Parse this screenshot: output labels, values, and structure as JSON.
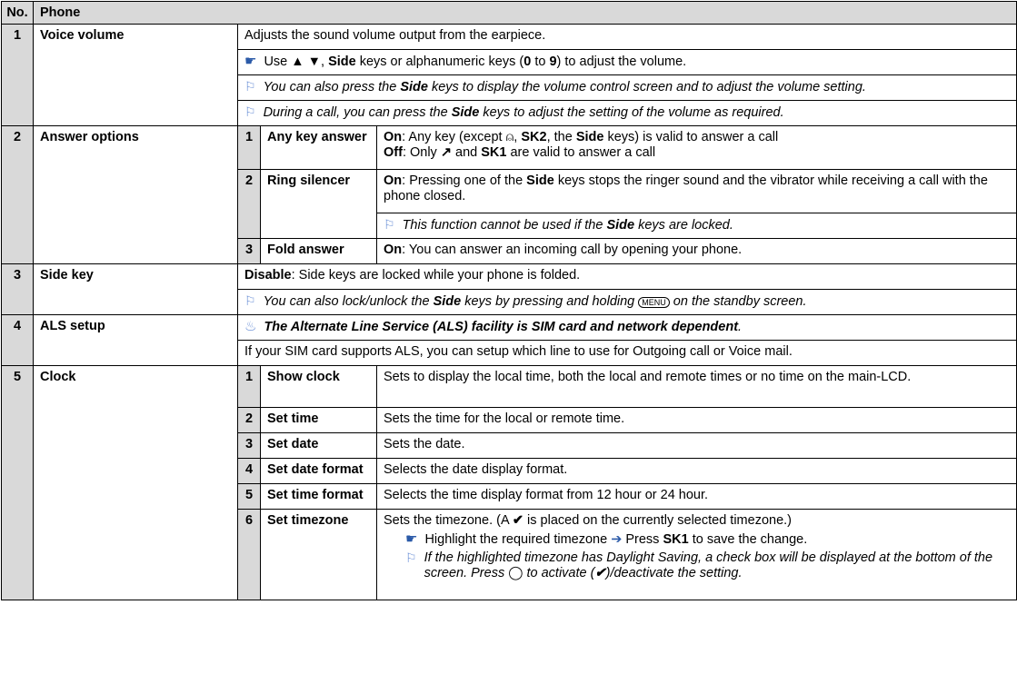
{
  "header": {
    "no_label": "No.",
    "title": "Phone"
  },
  "rows": {
    "r1": {
      "num": "1",
      "name": "Voice volume",
      "desc": "Adjusts the sound volume output from the earpiece.",
      "tip_a": "Use ▲ ▼, ",
      "tip_b": "Side",
      "tip_c": " keys or alphanumeric keys (",
      "tip_d": "0",
      "tip_e": " to ",
      "tip_f": "9",
      "tip_g": ") to adjust the volume.",
      "note1_a": "You can also press the ",
      "note1_b": "Side",
      "note1_c": " keys to display the volume control screen and to adjust the volume setting.",
      "note2_a": "During a call, you can press the ",
      "note2_b": "Side",
      "note2_c": " keys to adjust the setting of the volume as required."
    },
    "r2": {
      "num": "2",
      "name": "Answer options",
      "s1": {
        "num": "1",
        "name": "Any key answer",
        "on_label": "On",
        "on_a": ": Any key (except ",
        "on_b": ", ",
        "on_c": "SK2",
        "on_d": ", the ",
        "on_e": "Side",
        "on_f": " keys) is valid to answer a call",
        "off_label": "Off",
        "off_a": ": Only ",
        "off_b": " and ",
        "off_c": "SK1",
        "off_d": " are valid to answer a call"
      },
      "s2": {
        "num": "2",
        "name": "Ring silencer",
        "on_label": "On",
        "on_a": ": Pressing one of the ",
        "on_b": "Side",
        "on_c": " keys stops the ringer sound and the vibrator while receiving a call with the phone closed.",
        "note_a": "This function cannot be used if the ",
        "note_b": "Side",
        "note_c": " keys are locked."
      },
      "s3": {
        "num": "3",
        "name": "Fold answer",
        "on_label": "On",
        "on_a": ": You can answer an incoming call by opening your phone."
      }
    },
    "r3": {
      "num": "3",
      "name": "Side key",
      "dis_label": "Disable",
      "dis_text": ": Side keys are locked while your phone is folded.",
      "note_a": "You can also lock/unlock the ",
      "note_b": "Side",
      "note_c": " keys by pressing and holding ",
      "note_d": " on the standby screen."
    },
    "r4": {
      "num": "4",
      "name": "ALS setup",
      "warn": "The Alternate Line Service (ALS) facility is SIM card and network dependent",
      "warn_end": ".",
      "desc": "If your SIM card supports ALS, you can setup which line to use for Outgoing call or Voice mail."
    },
    "r5": {
      "num": "5",
      "name": "Clock",
      "subs": [
        {
          "num": "1",
          "name": "Show clock",
          "desc": "Sets to display the local time, both the local and remote times or no time on the main-LCD."
        },
        {
          "num": "2",
          "name": "Set time",
          "desc": "Sets the time for the local or remote time."
        },
        {
          "num": "3",
          "name": "Set date",
          "desc": "Sets the date."
        },
        {
          "num": "4",
          "name": "Set date format",
          "desc": "Selects the date display format."
        },
        {
          "num": "5",
          "name": "Set time format",
          "desc": "Selects the time display format from 12 hour or 24 hour."
        }
      ],
      "s6": {
        "num": "6",
        "name": "Set timezone",
        "desc_a": "Sets the timezone. (A ",
        "desc_b": "✔",
        "desc_c": " is placed on the currently selected timezone.)",
        "tip_a": "Highlight the required timezone ",
        "tip_arrow": "➔",
        "tip_b": " Press ",
        "tip_c": "SK1",
        "tip_d": " to save the change.",
        "note_a": "If the highlighted timezone has Daylight Saving, a check box will be displayed at the bottom of the screen. Press ",
        "note_b": " to activate (",
        "note_c": "✔",
        "note_d": ")/deactivate the setting."
      }
    }
  },
  "icons": {
    "hand": "☛",
    "flag": "⚐",
    "warn": "♨",
    "end_key": "⍝",
    "send_key": "↗",
    "menu_key": "MENU",
    "nav_key": "◯"
  }
}
